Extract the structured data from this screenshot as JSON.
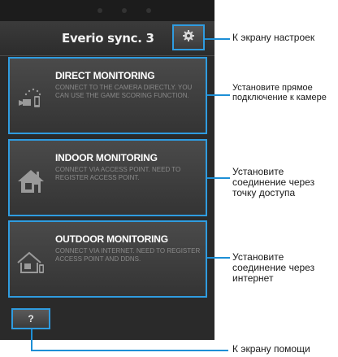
{
  "app": {
    "title": "Everio sync. 3"
  },
  "toolbar": {
    "settings_icon": "gear-icon"
  },
  "cards": [
    {
      "title": "DIRECT MONITORING",
      "description": "CONNECT TO THE CAMERA DIRECTLY. YOU CAN USE THE GAME SCORING FUNCTION.",
      "icon": "direct-camera-icon"
    },
    {
      "title": "INDOOR MONITORING",
      "description": "CONNECT VIA ACCESS POINT. NEED TO REGISTER ACCESS POINT.",
      "icon": "house-icon"
    },
    {
      "title": "OUTDOOR MONITORING",
      "description": "CONNECT VIA INTERNET. NEED TO REGISTER ACCESS POINT AND DDNS.",
      "icon": "house-internet-icon"
    }
  ],
  "help": {
    "label": "?"
  },
  "annotations": {
    "settings": "К экрану настроек",
    "direct": "Установите прямое подключение к камере",
    "indoor": "Установите соединение через точку доступа",
    "outdoor": "Установите соединение через интернет",
    "help": "К экрану помощи"
  },
  "colors": {
    "accent": "#2f9ce0",
    "background": "#2a2a2a",
    "leader_line": "#1d8fd6"
  }
}
